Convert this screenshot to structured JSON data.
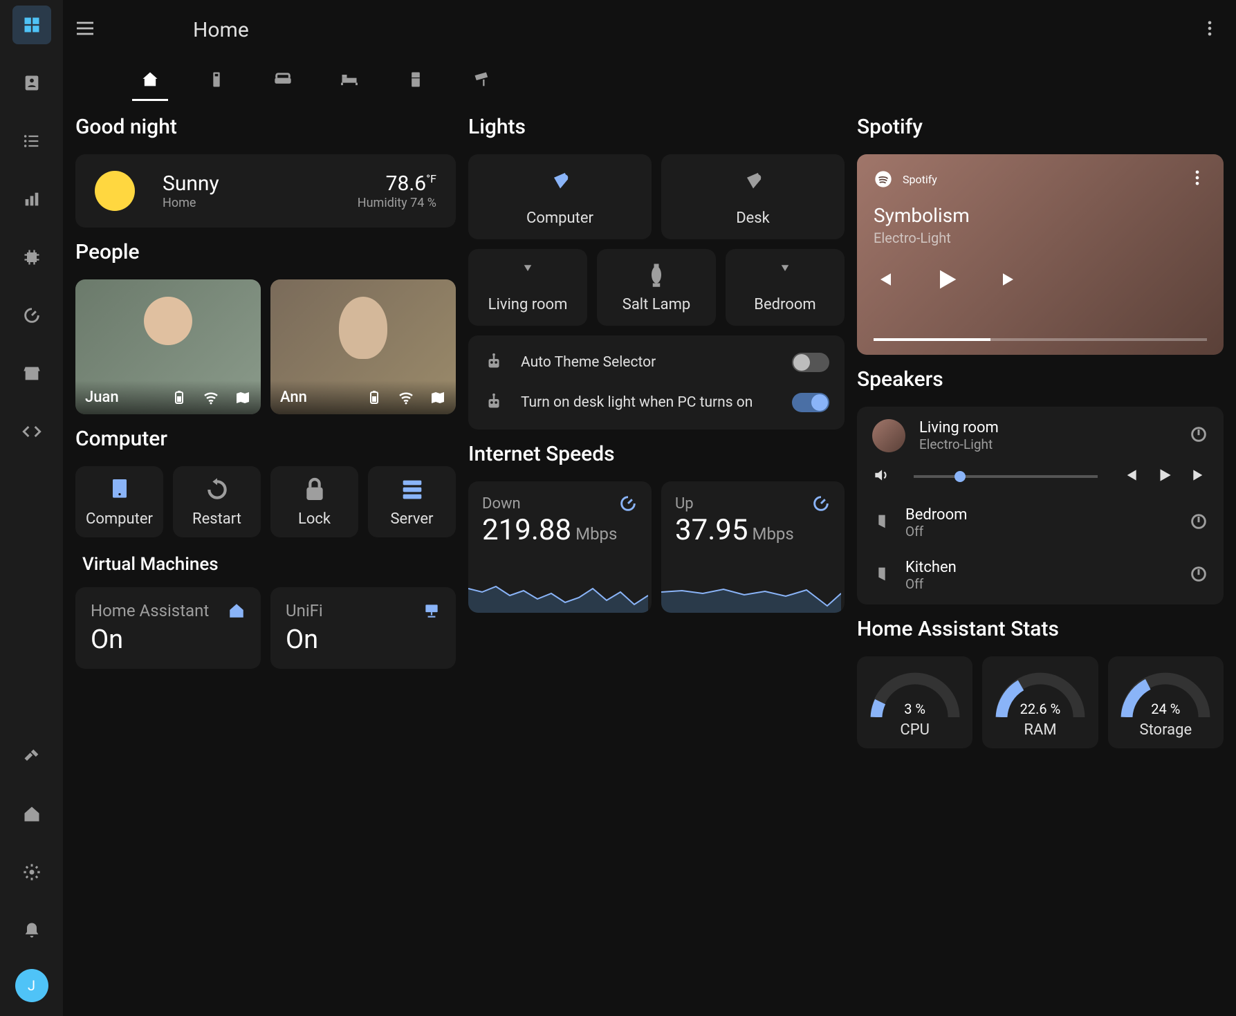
{
  "header": {
    "title": "Home"
  },
  "user_avatar_initial": "J",
  "sections": {
    "goodnight": "Good night",
    "people": "People",
    "computer": "Computer",
    "vms": "Virtual Machines",
    "lights": "Lights",
    "internet": "Internet Speeds",
    "spotify": "Spotify",
    "speakers": "Speakers",
    "stats": "Home Assistant Stats"
  },
  "weather": {
    "condition": "Sunny",
    "location": "Home",
    "temp": "78.6",
    "temp_unit": "°F",
    "humidity": "Humidity 74 %"
  },
  "people": [
    {
      "name": "Juan"
    },
    {
      "name": "Ann"
    }
  ],
  "computer_tiles": [
    {
      "label": "Computer",
      "icon": "desktop",
      "color": "blue"
    },
    {
      "label": "Restart",
      "icon": "restart",
      "color": "grey"
    },
    {
      "label": "Lock",
      "icon": "lock",
      "color": "grey"
    },
    {
      "label": "Server",
      "icon": "server",
      "color": "blue"
    }
  ],
  "vms": [
    {
      "name": "Home Assistant",
      "state": "On",
      "icon": "ha"
    },
    {
      "name": "UniFi",
      "state": "On",
      "icon": "network"
    }
  ],
  "lights": {
    "row1": [
      {
        "label": "Computer",
        "icon": "desk-lamp",
        "color": "blue"
      },
      {
        "label": "Desk",
        "icon": "desk-lamp",
        "color": "grey"
      }
    ],
    "row2": [
      {
        "label": "Living room",
        "icon": "floor-lamp",
        "color": "grey"
      },
      {
        "label": "Salt Lamp",
        "icon": "lava-lamp",
        "color": "grey"
      },
      {
        "label": "Bedroom",
        "icon": "floor-lamp",
        "color": "grey"
      }
    ]
  },
  "automations": [
    {
      "label": "Auto Theme Selector",
      "on": false
    },
    {
      "label": "Turn on desk light when PC turns on",
      "on": true
    }
  ],
  "speeds": {
    "down": {
      "label": "Down",
      "value": "219.88",
      "unit": "Mbps"
    },
    "up": {
      "label": "Up",
      "value": "37.95",
      "unit": "Mbps"
    }
  },
  "spotify": {
    "brand": "Spotify",
    "track": "Symbolism",
    "artist": "Electro-Light"
  },
  "speakers": [
    {
      "name": "Living room",
      "sub": "Electro-Light",
      "active": true
    },
    {
      "name": "Bedroom",
      "sub": "Off",
      "active": false
    },
    {
      "name": "Kitchen",
      "sub": "Off",
      "active": false
    }
  ],
  "stats": [
    {
      "label": "CPU",
      "value": "3 %",
      "pct": 3
    },
    {
      "label": "RAM",
      "value": "22.6 %",
      "pct": 22.6
    },
    {
      "label": "Storage",
      "value": "24 %",
      "pct": 24
    }
  ]
}
